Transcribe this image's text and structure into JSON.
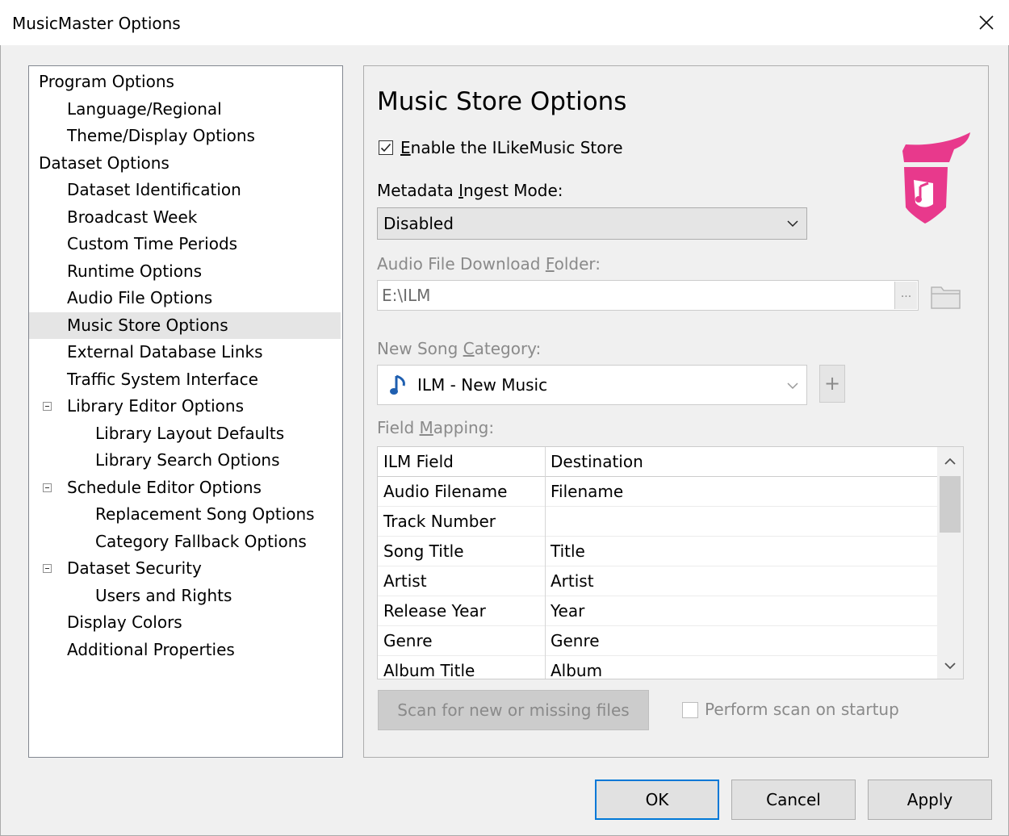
{
  "window": {
    "title": "MusicMaster Options"
  },
  "tree": [
    {
      "label": "Program Options",
      "level": 0
    },
    {
      "label": "Language/Regional",
      "level": 1
    },
    {
      "label": "Theme/Display Options",
      "level": 1
    },
    {
      "label": "Dataset Options",
      "level": 0
    },
    {
      "label": "Dataset Identification",
      "level": 1
    },
    {
      "label": "Broadcast Week",
      "level": 1
    },
    {
      "label": "Custom Time Periods",
      "level": 1
    },
    {
      "label": "Runtime Options",
      "level": 1
    },
    {
      "label": "Audio File Options",
      "level": 1
    },
    {
      "label": "Music Store Options",
      "level": 1,
      "selected": true
    },
    {
      "label": "External Database Links",
      "level": 1
    },
    {
      "label": "Traffic System Interface",
      "level": 1
    },
    {
      "label": "Library Editor Options",
      "level": 1,
      "expander": true
    },
    {
      "label": "Library Layout Defaults",
      "level": 2
    },
    {
      "label": "Library Search Options",
      "level": 2
    },
    {
      "label": "Schedule Editor Options",
      "level": 1,
      "expander": true
    },
    {
      "label": "Replacement Song Options",
      "level": 2
    },
    {
      "label": "Category Fallback Options",
      "level": 2
    },
    {
      "label": "Dataset Security",
      "level": 1,
      "expander": true
    },
    {
      "label": "Users and Rights",
      "level": 2
    },
    {
      "label": "Display Colors",
      "level": 1
    },
    {
      "label": "Additional Properties",
      "level": 1
    }
  ],
  "panel": {
    "heading": "Music Store Options",
    "enable_store": {
      "label_accel": "E",
      "label_rest": "nable the ILikeMusic Store",
      "checked": true
    },
    "ingest_mode": {
      "label_pre": "Metadata ",
      "label_accel": "I",
      "label_rest": "ngest Mode:",
      "value": "Disabled"
    },
    "download_folder": {
      "label_pre": "Audio File Download ",
      "label_accel": "F",
      "label_rest": "older:",
      "value": "E:\\ILM",
      "browse_label": "..."
    },
    "new_song_category": {
      "label_pre": "New Song ",
      "label_accel": "C",
      "label_rest": "ategory:",
      "value": "ILM - New Music",
      "add_label": "+"
    },
    "field_mapping": {
      "label_pre": "Field ",
      "label_accel": "M",
      "label_rest": "apping:",
      "columns": [
        "ILM Field",
        "Destination"
      ],
      "rows": [
        [
          "Audio Filename",
          "Filename"
        ],
        [
          "Track Number",
          ""
        ],
        [
          "Song Title",
          "Title"
        ],
        [
          "Artist",
          "Artist"
        ],
        [
          "Release Year",
          "Year"
        ],
        [
          "Genre",
          "Genre"
        ],
        [
          "Album Title",
          "Album"
        ]
      ]
    },
    "scan_button": "Scan for new or missing files",
    "scan_on_startup": {
      "label": "Perform scan on startup",
      "checked": false
    }
  },
  "buttons": {
    "ok": "OK",
    "cancel": "Cancel",
    "apply": "Apply"
  },
  "colors": {
    "logo": "#e8398c",
    "accent": "#0078d7",
    "note_icon": "#1f5fb0"
  }
}
